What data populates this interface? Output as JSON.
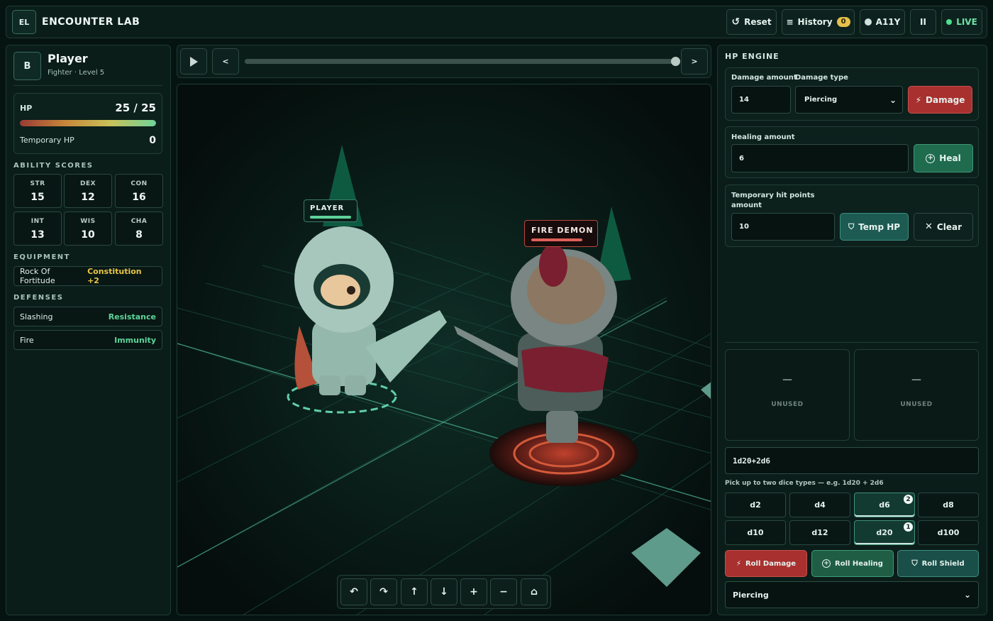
{
  "app": {
    "logo": "EL",
    "title": "ENCOUNTER LAB"
  },
  "topbar": {
    "reset": "Reset",
    "history": "History",
    "history_count": "0",
    "a11y": "A11Y",
    "pause": "II",
    "live": "LIVE"
  },
  "character": {
    "badge": "B",
    "name": "Player",
    "subtitle": "Fighter · Level 5",
    "hp_label": "HP",
    "hp_value": "25 / 25",
    "hp_fraction": 1.0,
    "temp_hp_label": "Temporary HP",
    "temp_hp_value": "0"
  },
  "abilities": {
    "title": "ABILITY SCORES",
    "items": [
      {
        "key": "STR",
        "value": "15"
      },
      {
        "key": "DEX",
        "value": "12"
      },
      {
        "key": "CON",
        "value": "16"
      },
      {
        "key": "INT",
        "value": "13"
      },
      {
        "key": "WIS",
        "value": "10"
      },
      {
        "key": "CHA",
        "value": "8"
      }
    ]
  },
  "equipment": {
    "title": "EQUIPMENT",
    "items": [
      {
        "name": "Rock Of Fortitude",
        "bonus": "Constitution +2"
      }
    ]
  },
  "defenses": {
    "title": "DEFENSES",
    "items": [
      {
        "name": "Slashing",
        "type": "Resistance"
      },
      {
        "name": "Fire",
        "type": "Immunity"
      }
    ]
  },
  "scene": {
    "player_label": "PLAYER",
    "enemy_label": "FIRE DEMON",
    "timeline_fraction": 1.0
  },
  "engine": {
    "title": "HP ENGINE",
    "damage_amount_label": "Damage amount",
    "damage_amount_value": "14",
    "damage_type_label": "Damage type",
    "damage_type_value": "Piercing",
    "damage_button": "Damage",
    "healing_label": "Healing amount",
    "healing_value": "6",
    "heal_button": "Heal",
    "temp_label_line1": "Temporary hit points",
    "temp_label_line2": "amount",
    "temp_value": "10",
    "temp_button": "Temp HP",
    "clear_button": "Clear",
    "slot1": "UNUSED",
    "slot2": "UNUSED",
    "slot_dash": "—",
    "formula": "1d20+2d6",
    "hint": "Pick up to two dice types — e.g. 1d20 + 2d6",
    "dice": [
      {
        "label": "d2"
      },
      {
        "label": "d4"
      },
      {
        "label": "d6",
        "count": "2"
      },
      {
        "label": "d8"
      },
      {
        "label": "d10"
      },
      {
        "label": "d12"
      },
      {
        "label": "d20",
        "count": "1"
      },
      {
        "label": "d100"
      }
    ],
    "roll_damage": "Roll Damage",
    "roll_healing": "Roll Healing",
    "roll_shield": "Roll Shield",
    "roll_type": "Piercing"
  },
  "colors": {
    "accent": "#2a7a63",
    "danger": "#a8302f",
    "gold": "#e9c545",
    "defense": "#5fd39a"
  }
}
